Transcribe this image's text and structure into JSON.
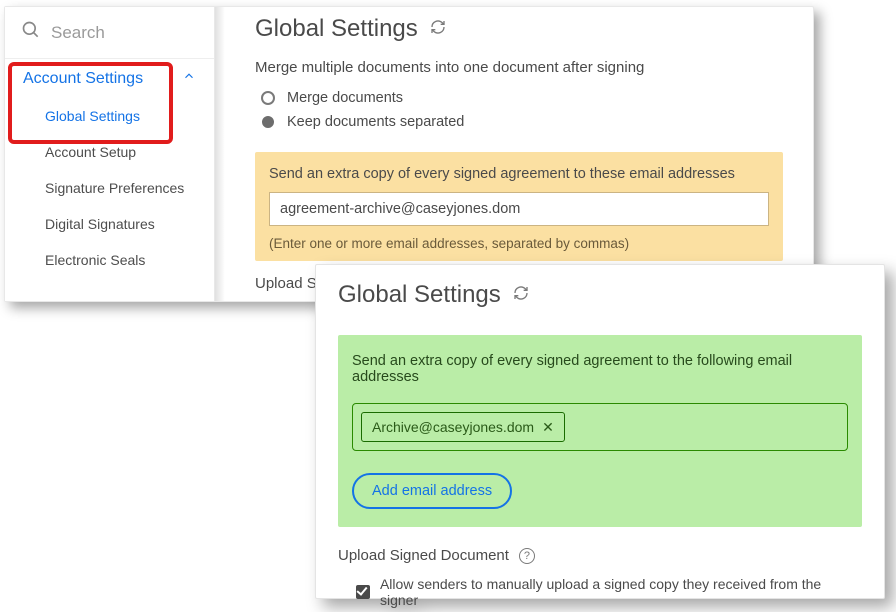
{
  "sidebar": {
    "search_placeholder": "Search",
    "account_settings_label": "Account Settings",
    "items": [
      {
        "label": "Global Settings"
      },
      {
        "label": "Account Setup"
      },
      {
        "label": "Signature Preferences"
      },
      {
        "label": "Digital Signatures"
      },
      {
        "label": "Electronic Seals"
      }
    ]
  },
  "panel1": {
    "title": "Global Settings",
    "merge_heading": "Merge multiple documents into one document after signing",
    "merge_option": "Merge documents",
    "keep_option": "Keep documents separated",
    "cc_heading": "Send an extra copy of every signed agreement to these email addresses",
    "cc_value": "agreement-archive@caseyjones.dom",
    "cc_hint": "(Enter one or more email addresses, separated by commas)",
    "upload_stub": "Upload S"
  },
  "panel2": {
    "title": "Global Settings",
    "cc_heading": "Send an extra copy of every signed agreement to the following email addresses",
    "chip_email": "Archive@caseyjones.dom",
    "add_button": "Add email address",
    "upload_heading": "Upload Signed Document",
    "allow_label": "Allow senders to manually upload a signed copy they received from the signer"
  }
}
